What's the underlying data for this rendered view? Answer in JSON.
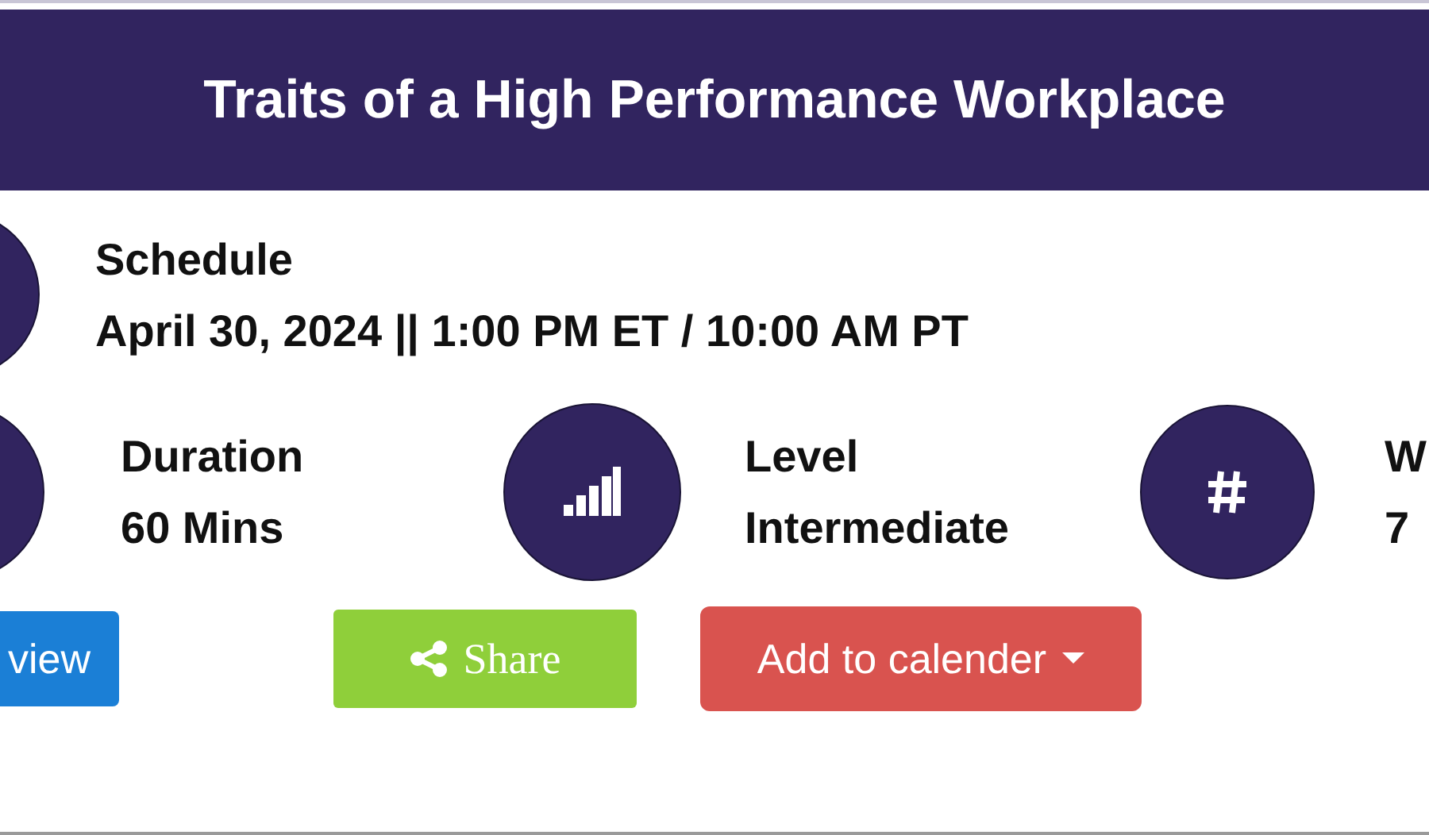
{
  "header": {
    "title": "Traits of a High Performance Workplace"
  },
  "schedule": {
    "label": "Schedule",
    "value": "April 30, 2024 || 1:00 PM ET / 10:00 AM PT"
  },
  "details": [
    {
      "kind": "duration",
      "label": "Duration",
      "value": "60 Mins"
    },
    {
      "kind": "level",
      "label": "Level",
      "value": "Intermediate"
    },
    {
      "kind": "number",
      "label": "W",
      "value": "7"
    }
  ],
  "buttons": [
    {
      "kind": "preview",
      "label": "view"
    },
    {
      "kind": "share",
      "label": "Share"
    },
    {
      "kind": "calendar",
      "label": "Add to calender"
    }
  ]
}
